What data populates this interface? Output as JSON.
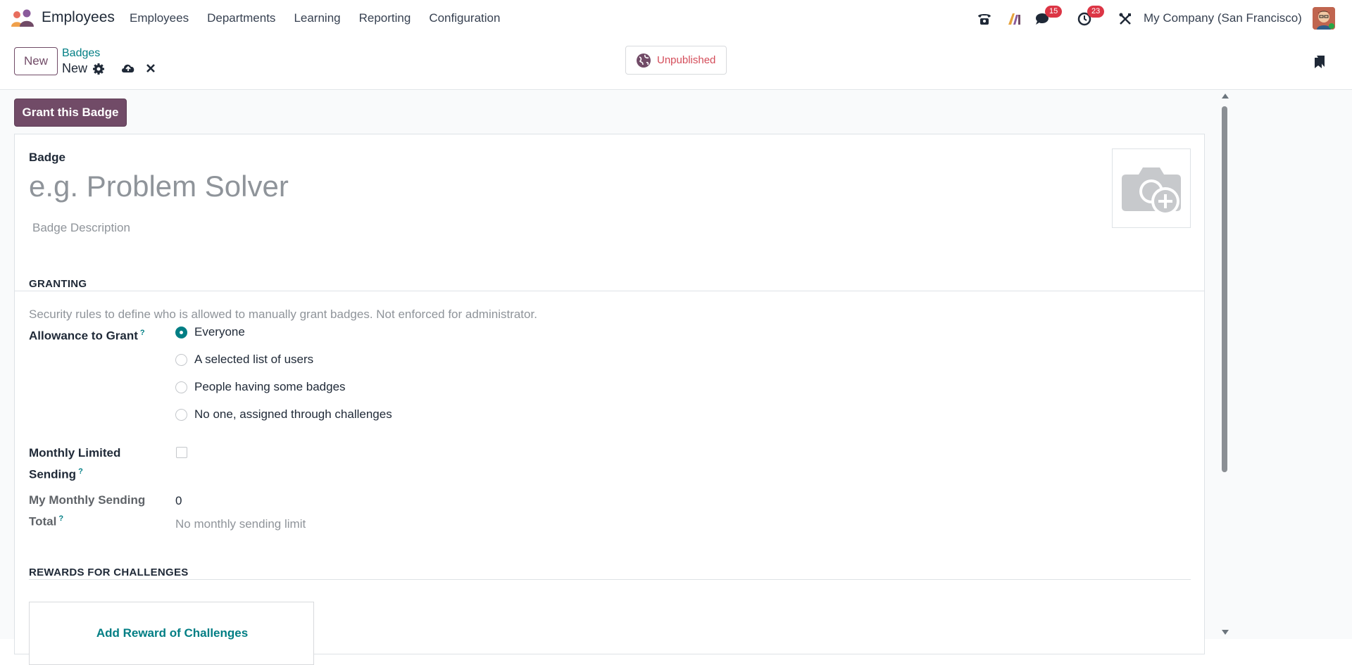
{
  "navbar": {
    "app_name": "Employees",
    "menu": [
      "Employees",
      "Departments",
      "Learning",
      "Reporting",
      "Configuration"
    ],
    "messages_count": "15",
    "activities_count": "23",
    "company": "My Company (San Francisco)"
  },
  "control": {
    "new_label": "New",
    "breadcrumb_parent": "Badges",
    "breadcrumb_current": "New",
    "status_label": "Unpublished"
  },
  "form": {
    "grant_button": "Grant this Badge",
    "badge_label": "Badge",
    "badge_placeholder": "e.g. Problem Solver",
    "description_placeholder": "Badge Description",
    "granting_title": "GRANTING",
    "granting_help": "Security rules to define who is allowed to manually grant badges. Not enforced for administrator.",
    "allowance_label": "Allowance to Grant",
    "allowance_options": [
      "Everyone",
      "A selected list of users",
      "People having some badges",
      "No one, assigned through challenges"
    ],
    "allowance_selected": "Everyone",
    "monthly_limited_label_1": "Monthly Limited",
    "monthly_limited_label_2": "Sending",
    "monthly_limited_checked": false,
    "monthly_total_label_1": "My Monthly Sending",
    "monthly_total_label_2": "Total",
    "monthly_total_value": "0",
    "monthly_total_note": "No monthly sending limit",
    "rewards_title": "REWARDS FOR CHALLENGES",
    "add_reward_label": "Add Reward of Challenges",
    "tooltip_marker": "?"
  },
  "colors": {
    "primary": "#714b67",
    "link": "#017e84",
    "danger": "#dc3545"
  },
  "icons": [
    "app-logo-icon",
    "phone-icon",
    "ai-icon",
    "chat-icon",
    "clock-icon",
    "tools-icon",
    "gear-icon",
    "cloud-upload-icon",
    "close-icon",
    "globe-icon",
    "bookmark-icon",
    "camera-plus-icon"
  ]
}
